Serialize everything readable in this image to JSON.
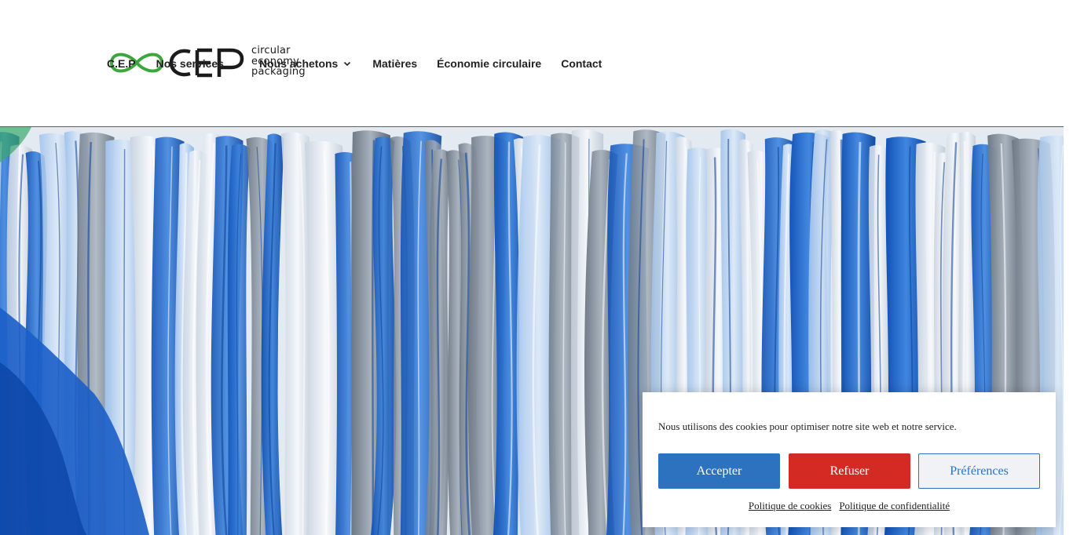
{
  "brand": {
    "logo_mark": "CEP",
    "logo_line1": "circular",
    "logo_line2": "economy",
    "logo_line3": "packaging",
    "logo_green": "#3aa63c",
    "logo_dark": "#1b1b1b"
  },
  "nav": {
    "items": [
      {
        "label": "C.E.P",
        "has_dropdown": false
      },
      {
        "label": "Nos services",
        "has_dropdown": false
      },
      {
        "label": "Nous achetons",
        "has_dropdown": true
      },
      {
        "label": "Matières",
        "has_dropdown": false
      },
      {
        "label": "Économie circulaire",
        "has_dropdown": false
      },
      {
        "label": "Contact",
        "has_dropdown": false
      }
    ],
    "dropdown_icon": "chevron-down-icon"
  },
  "hero": {
    "image_description": "bales of plastic film",
    "accent_blue": "#1d63c4"
  },
  "cookie": {
    "message": "Nous utilisons des cookies pour optimiser notre site web et notre service.",
    "accept_label": "Accepter",
    "refuse_label": "Refuser",
    "prefs_label": "Préférences",
    "cookie_policy_label": "Politique de cookies",
    "privacy_policy_label": "Politique de confidentialité",
    "colors": {
      "accept": "#2c72bf",
      "refuse": "#d42a24",
      "prefs_bg": "#f0f2f5"
    }
  }
}
